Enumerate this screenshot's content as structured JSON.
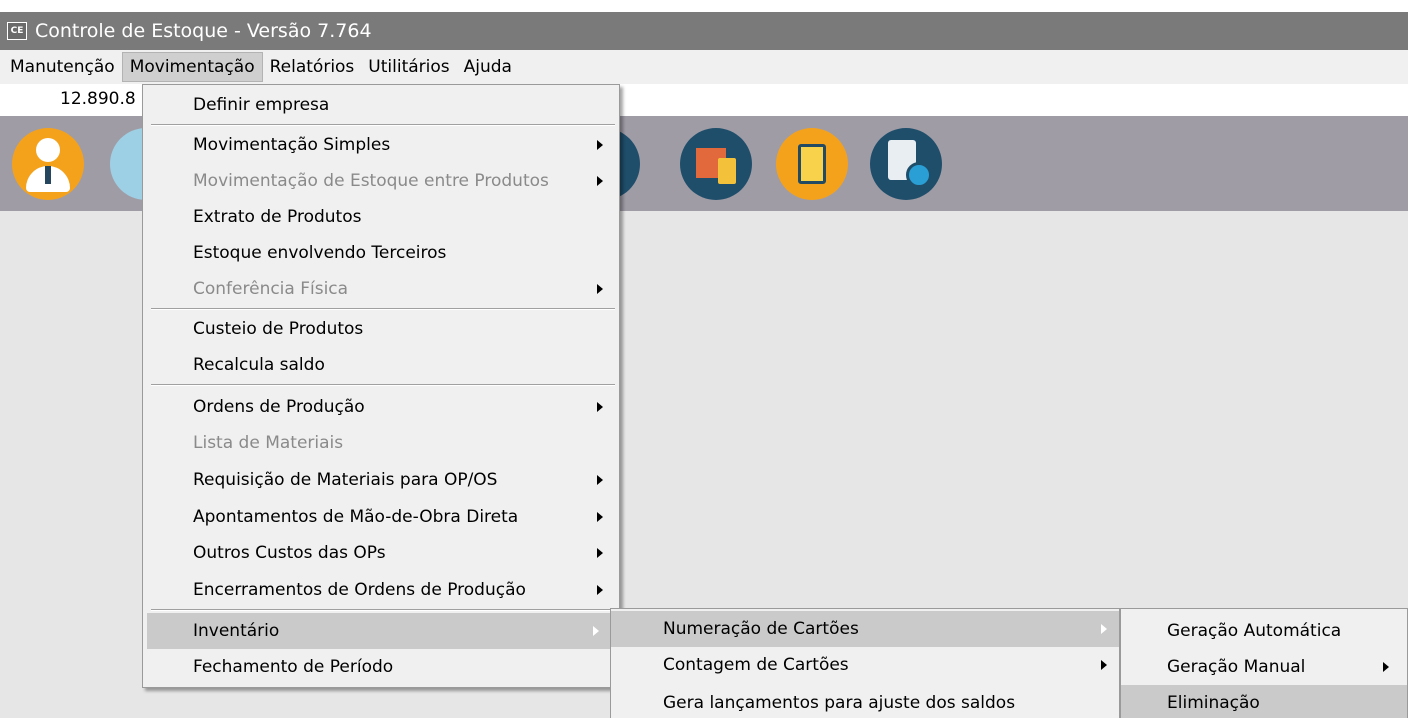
{
  "window": {
    "app_icon_text": "CE",
    "title": "Controle de Estoque - Versão 7.764"
  },
  "menubar": [
    {
      "label": "Manutenção",
      "active": false
    },
    {
      "label": "Movimentação",
      "active": true
    },
    {
      "label": "Relatórios",
      "active": false
    },
    {
      "label": "Utilitários",
      "active": false
    },
    {
      "label": "Ajuda",
      "active": false
    }
  ],
  "status": {
    "value": "12.890.8"
  },
  "toolbar": {
    "icons": [
      "user-icon",
      "truck-icon",
      "money-box-icon",
      "box-clipboard-icon",
      "clipboard-location-icon",
      "clipboard-check-icon"
    ],
    "colors": {
      "orange": "#f4a21c",
      "navy": "#1f4e6b",
      "background": "#a09ca6"
    }
  },
  "movimentacao_menu": {
    "items": [
      {
        "label": "Definir empresa"
      },
      {
        "label": "Movimentação Simples"
      },
      {
        "label": "Movimentação de Estoque entre Produtos"
      },
      {
        "label": "Extrato de Produtos"
      },
      {
        "label": "Estoque envolvendo Terceiros"
      },
      {
        "label": "Conferência Física"
      },
      {
        "label": "Custeio de Produtos"
      },
      {
        "label": "Recalcula saldo"
      },
      {
        "label": "Ordens de Produção"
      },
      {
        "label": "Lista de Materiais"
      },
      {
        "label": "Requisição de Materiais para OP/OS"
      },
      {
        "label": "Apontamentos de Mão-de-Obra Direta"
      },
      {
        "label": "Outros Custos das OPs"
      },
      {
        "label": "Encerramentos de Ordens de Produção"
      },
      {
        "label": "Inventário"
      },
      {
        "label": "Fechamento de Período"
      }
    ]
  },
  "inventario_menu": {
    "items": [
      {
        "label": "Numeração de  Cartões"
      },
      {
        "label": "Contagem de Cartões"
      },
      {
        "label": "Gera lançamentos para ajuste dos saldos"
      }
    ]
  },
  "numeracao_menu": {
    "items": [
      {
        "label": "Geração Automática"
      },
      {
        "label": "Geração Manual"
      },
      {
        "label": "Eliminação"
      }
    ]
  }
}
